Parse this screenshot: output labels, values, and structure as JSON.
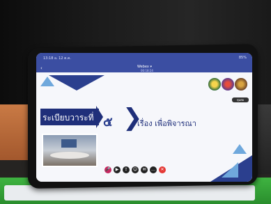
{
  "statusbar": {
    "time": "13:18 อ. 12 ต.ค.",
    "battery": "85%"
  },
  "meeting": {
    "title": "Webex ▾",
    "subtitle": "00:18:24"
  },
  "slide": {
    "heading": "ระเบียบวาระที่",
    "number": "๕",
    "subject": "เรื่อง  เพื่อพิจารณา",
    "mini_button": "ปุ่มต่อ"
  },
  "controls": [
    {
      "icon": "mute-icon",
      "glyph": "🎤"
    },
    {
      "icon": "video-icon",
      "glyph": "▶"
    },
    {
      "icon": "share-icon",
      "glyph": "⇪"
    },
    {
      "icon": "participants-icon",
      "glyph": "☺"
    },
    {
      "icon": "chat-icon",
      "glyph": "✉"
    },
    {
      "icon": "more-icon",
      "glyph": "…"
    },
    {
      "icon": "leave-icon",
      "glyph": "✕"
    }
  ],
  "colors": {
    "accent": "#1f2f7a",
    "light": "#6fa8dc",
    "leave": "#e53935"
  }
}
